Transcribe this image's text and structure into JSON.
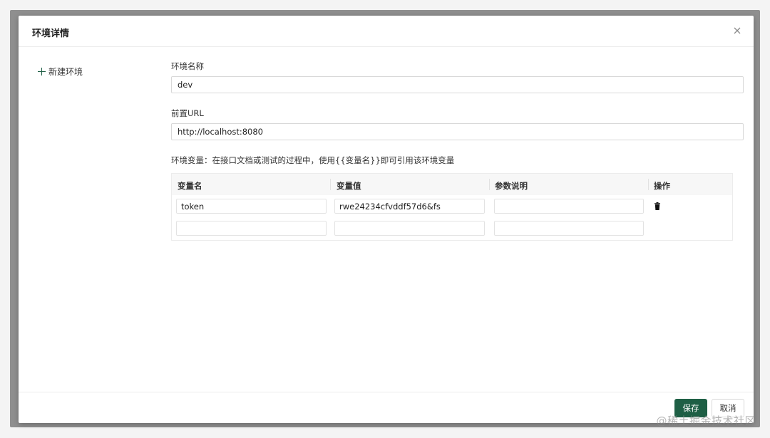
{
  "dialog": {
    "title": "环境详情",
    "close_icon": "close-icon"
  },
  "sidebar": {
    "new_env_label": "新建环境",
    "new_env_icon": "plus-icon"
  },
  "form": {
    "env_name_label": "环境名称",
    "env_name_value": "dev",
    "base_url_label": "前置URL",
    "base_url_value": "http://localhost:8080",
    "var_hint": "环境变量：在接口文档或测试的过程中，使用{{变量名}}即可引用该环境变量"
  },
  "variables_table": {
    "headers": {
      "name": "变量名",
      "value": "变量值",
      "description": "参数说明",
      "actions": "操作"
    },
    "rows": [
      {
        "name": "token",
        "value": "rwe24234cfvddf57d6&fs",
        "description": ""
      },
      {
        "name": "",
        "value": "",
        "description": ""
      }
    ],
    "delete_icon": "trash-icon"
  },
  "footer": {
    "save_label": "保存",
    "cancel_label": "取消"
  },
  "watermark": "@稀土掘金技术社区",
  "colors": {
    "primary": "#1e5f45",
    "border": "#d8d8d8",
    "header_bg": "#f7f7f7"
  }
}
